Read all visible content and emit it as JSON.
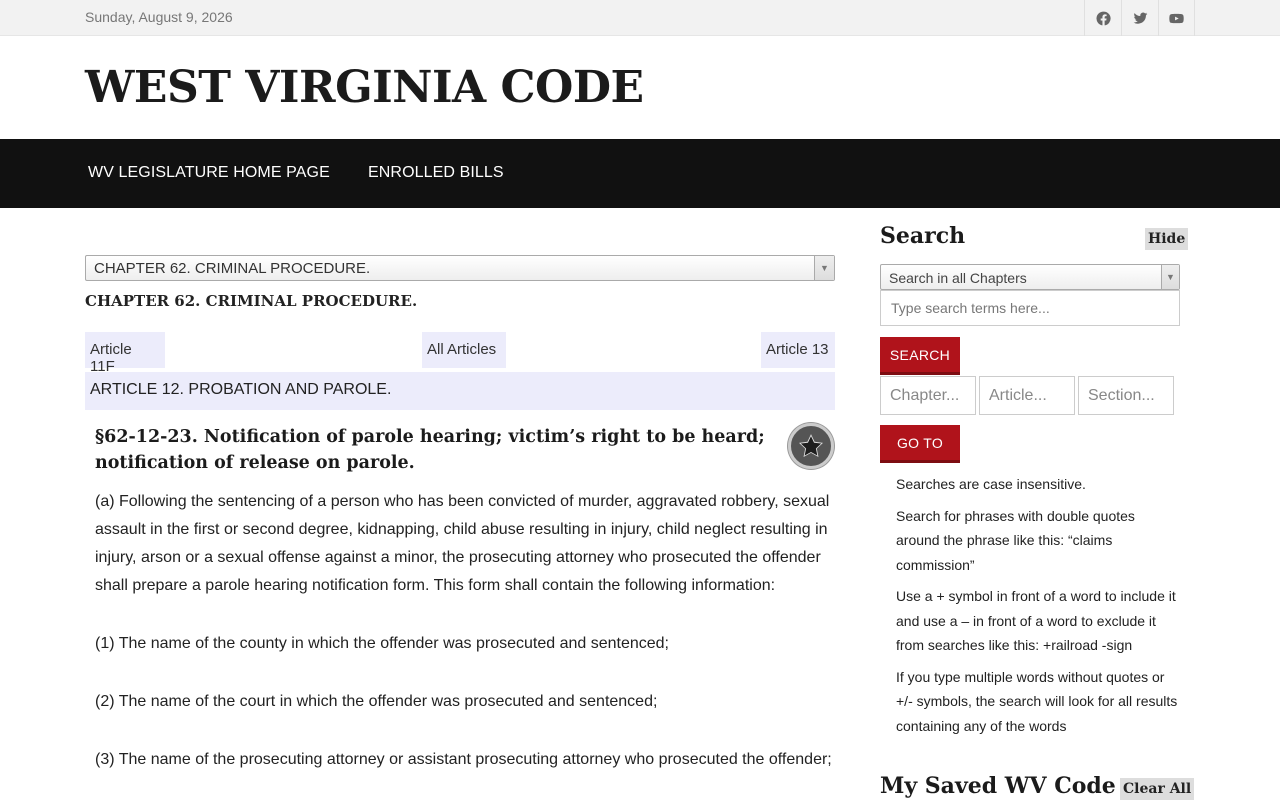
{
  "topbar": {
    "date": "Sunday, August 9, 2026",
    "social_icons": [
      "facebook-icon",
      "twitter-icon",
      "youtube-icon"
    ]
  },
  "header": {
    "title": "WEST VIRGINIA CODE"
  },
  "nav": {
    "items": [
      "WV LEGISLATURE HOME PAGE",
      "ENROLLED BILLS"
    ]
  },
  "main": {
    "chapter_select": "CHAPTER 62. CRIMINAL PROCEDURE.",
    "chapter_heading": "CHAPTER 62. CRIMINAL PROCEDURE.",
    "article_nav": {
      "prev": "Article 11F",
      "all": "All Articles",
      "next": "Article 13"
    },
    "article_title": "ARTICLE 12. PROBATION AND PAROLE.",
    "section_title": "§62-12-23. Notification of parole hearing; victim’s right to be heard; notification of release on parole.",
    "paragraphs": [
      "(a) Following the sentencing of a person who has been convicted of murder, aggravated robbery, sexual assault in the first or second degree, kidnapping, child abuse resulting in injury, child neglect resulting in injury, arson or a sexual offense against a minor, the prosecuting attorney who prosecuted the offender shall prepare a parole hearing notification form. This form shall contain the following information:",
      "(1) The name of the county in which the offender was prosecuted and sentenced;",
      "(2) The name of the court in which the offender was prosecuted and sentenced;",
      "(3) The name of the prosecuting attorney or assistant prosecuting attorney who prosecuted the offender;"
    ]
  },
  "sidebar": {
    "search_heading": "Search",
    "hide_label": "Hide",
    "scope_select": "Search in all Chapters",
    "search_placeholder": "Type search terms here...",
    "search_button": "SEARCH",
    "chapter_placeholder": "Chapter...",
    "article_placeholder": "Article...",
    "section_placeholder": "Section...",
    "goto_button": "GO TO",
    "tips": [
      "Searches are case insensitive.",
      "Search for phrases with double quotes around the phrase like this: “claims commission”",
      "Use a + symbol in front of a word to include it and use a – in front of a word to exclude it from searches like this: +railroad -sign",
      "If you type multiple words without quotes or +/- symbols, the search will look for all results containing any of the words"
    ],
    "saved_heading": "My Saved WV Code",
    "clear_label": "Clear All"
  }
}
